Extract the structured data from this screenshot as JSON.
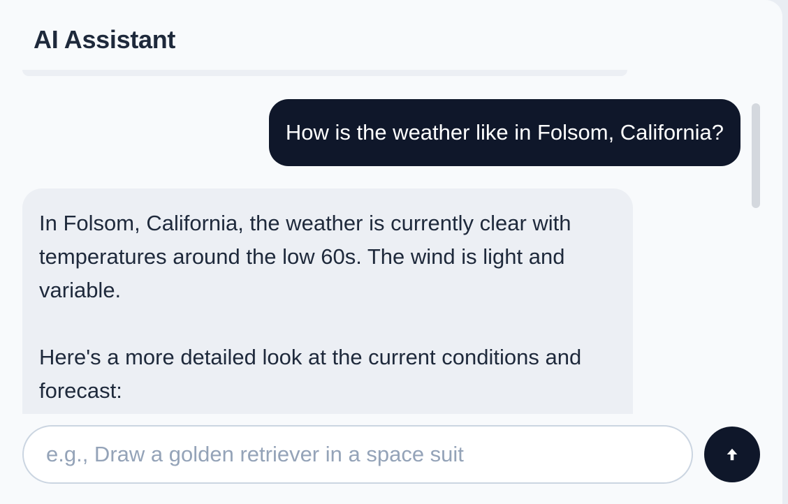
{
  "header": {
    "title": "AI Assistant"
  },
  "messages": [
    {
      "role": "user",
      "text": "How is the weather like in Folsom, California?"
    },
    {
      "role": "assistant",
      "paragraphs": [
        "In Folsom, California, the weather is currently clear with temperatures around the low 60s. The wind is light and variable.",
        "Here's a more detailed look at the current conditions and forecast:"
      ]
    }
  ],
  "composer": {
    "placeholder": "e.g., Draw a golden retriever in a space suit",
    "value": "",
    "send_icon": "arrow-up-icon"
  },
  "colors": {
    "user_bubble": "#0f172a",
    "assistant_bubble": "#eceff4",
    "send_button": "#0f172a",
    "panel_background": "#f8fafc"
  }
}
